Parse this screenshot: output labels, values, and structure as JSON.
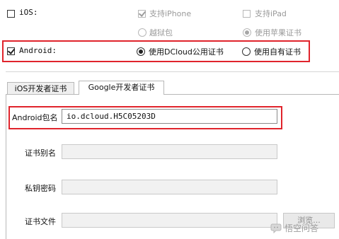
{
  "platforms": {
    "ios": {
      "label": "iOS:",
      "checked": false
    },
    "android": {
      "label": "Android:",
      "checked": true
    }
  },
  "ios_options": {
    "support_iphone": {
      "label": "支持iPhone",
      "checked": true,
      "disabled": true
    },
    "support_ipad": {
      "label": "支持iPad",
      "checked": false,
      "disabled": true
    },
    "jailbreak": {
      "label": "越狱包",
      "selected": false,
      "disabled": true
    },
    "apple_cert": {
      "label": "使用苹果证书",
      "selected": true,
      "disabled": true
    }
  },
  "android_options": {
    "dcloud_cert": {
      "label": "使用DCloud公用证书",
      "selected": true
    },
    "own_cert": {
      "label": "使用自有证书",
      "selected": false
    }
  },
  "tabs": [
    {
      "label": "iOS开发者证书",
      "active": false
    },
    {
      "label": "Google开发者证书",
      "active": true
    }
  ],
  "form": {
    "package_name": {
      "label": "Android包名",
      "value": "io.dcloud.H5C05203D"
    },
    "cert_alias": {
      "label": "证书别名",
      "value": ""
    },
    "private_key_password": {
      "label": "私钥密码",
      "value": ""
    },
    "cert_file": {
      "label": "证书文件",
      "value": ""
    }
  },
  "browse_button": {
    "label": "浏览..."
  },
  "watermark": {
    "text": "悟空问答"
  },
  "colors": {
    "highlight": "#e0242c",
    "disabled_text": "#9a9a9a",
    "field_bg": "#f1f1f1"
  }
}
